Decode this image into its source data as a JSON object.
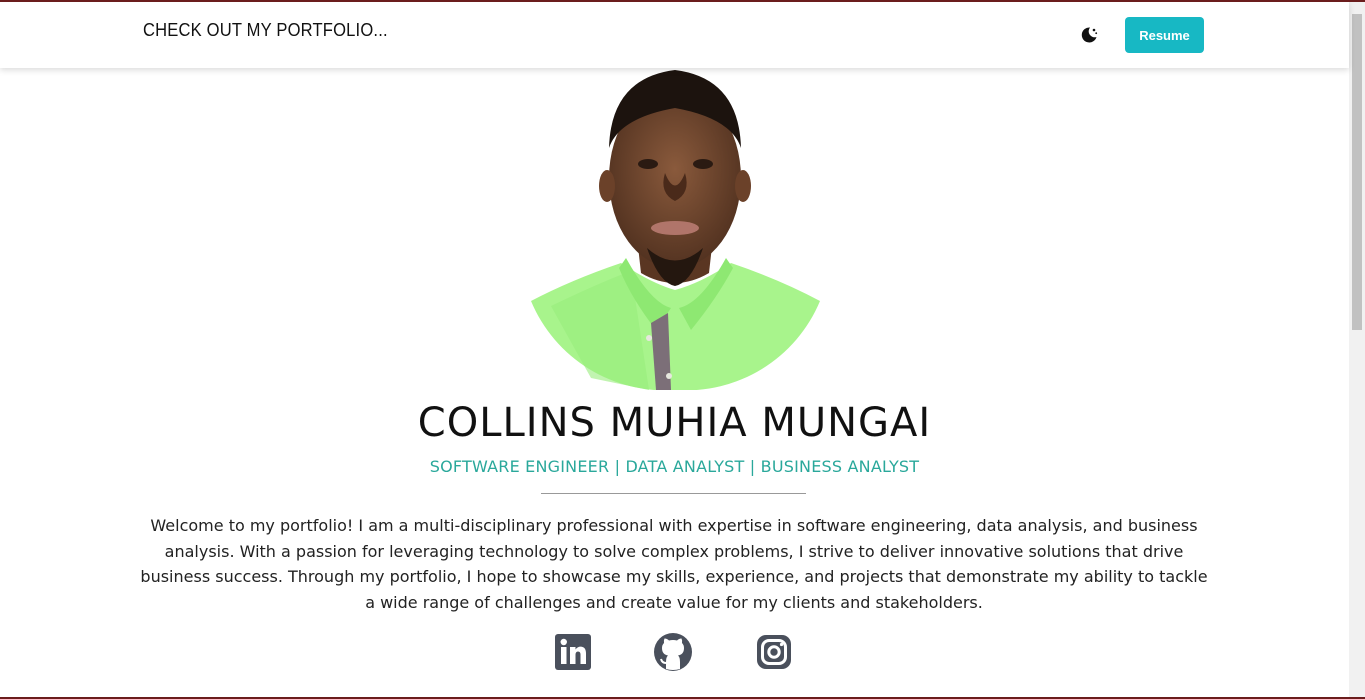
{
  "navbar": {
    "brand": "CHECK OUT MY PORTFOLIO...",
    "theme_toggle_icon": "moon-icon",
    "resume_label": "Resume"
  },
  "hero": {
    "photo_icon": "profile-photo",
    "name": "COLLINS MUHIA MUNGAI",
    "roles": "SOFTWARE ENGINEER | DATA ANALYST | BUSINESS ANALYST",
    "bio": "Welcome to my portfolio! I am a multi-disciplinary professional with expertise in software engineering, data analysis, and business analysis. With a passion for leveraging technology to solve complex problems, I strive to deliver innovative solutions that drive business success. Through my portfolio, I hope to showcase my skills, experience, and projects that demonstrate my ability to tackle a wide range of challenges and create value for my clients and stakeholders."
  },
  "social": [
    {
      "icon": "linkedin-icon"
    },
    {
      "icon": "github-icon"
    },
    {
      "icon": "instagram-icon"
    }
  ],
  "colors": {
    "accent": "#17b8c4",
    "roles_text": "#2aa89b",
    "icon_gray": "#4a505c",
    "frame_border": "#6b1d1d"
  }
}
